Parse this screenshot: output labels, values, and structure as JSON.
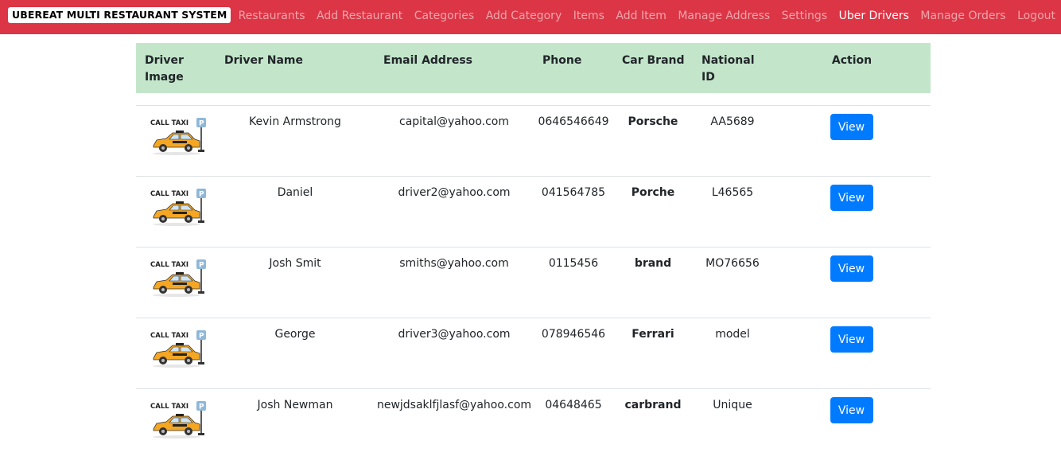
{
  "navbar": {
    "brand": "UBEREAT MULTI RESTAURANT SYSTEM",
    "links": [
      {
        "label": "Restaurants",
        "active": false
      },
      {
        "label": "Add Restaurant",
        "active": false
      },
      {
        "label": "Categories",
        "active": false
      },
      {
        "label": "Add Category",
        "active": false
      },
      {
        "label": "Items",
        "active": false
      },
      {
        "label": "Add Item",
        "active": false
      },
      {
        "label": "Manage Address",
        "active": false
      },
      {
        "label": "Settings",
        "active": false
      },
      {
        "label": "Uber Drivers",
        "active": true
      },
      {
        "label": "Manage Orders",
        "active": false
      },
      {
        "label": "Logout",
        "active": false
      }
    ]
  },
  "colors": {
    "navbar": "#dc3545",
    "header_row": "#c3e6cb",
    "button": "#007bff",
    "taxi": "#f5a623"
  },
  "table": {
    "headers": [
      "Driver Image",
      "Driver Name",
      "Email Address",
      "Phone",
      "Car Brand",
      "National ID",
      "Action"
    ],
    "image_caption": "CALL TAXI",
    "image_sign": "P",
    "button_label": "View",
    "rows": [
      {
        "name": "Kevin Armstrong",
        "email": "capital@yahoo.com",
        "phone": "0646546649",
        "car_brand": "Porsche",
        "national_id": "AA5689"
      },
      {
        "name": "Daniel",
        "email": "driver2@yahoo.com",
        "phone": "041564785",
        "car_brand": "Porche",
        "national_id": "L46565"
      },
      {
        "name": "Josh Smit",
        "email": "smiths@yahoo.com",
        "phone": "0115456",
        "car_brand": "brand",
        "national_id": "MO76656"
      },
      {
        "name": "George",
        "email": "driver3@yahoo.com",
        "phone": "078946546",
        "car_brand": "Ferrari",
        "national_id": "model"
      },
      {
        "name": "Josh Newman",
        "email": "newjdsaklfjlasf@yahoo.com",
        "phone": "04648465",
        "car_brand": "carbrand",
        "national_id": "Unique"
      }
    ]
  }
}
